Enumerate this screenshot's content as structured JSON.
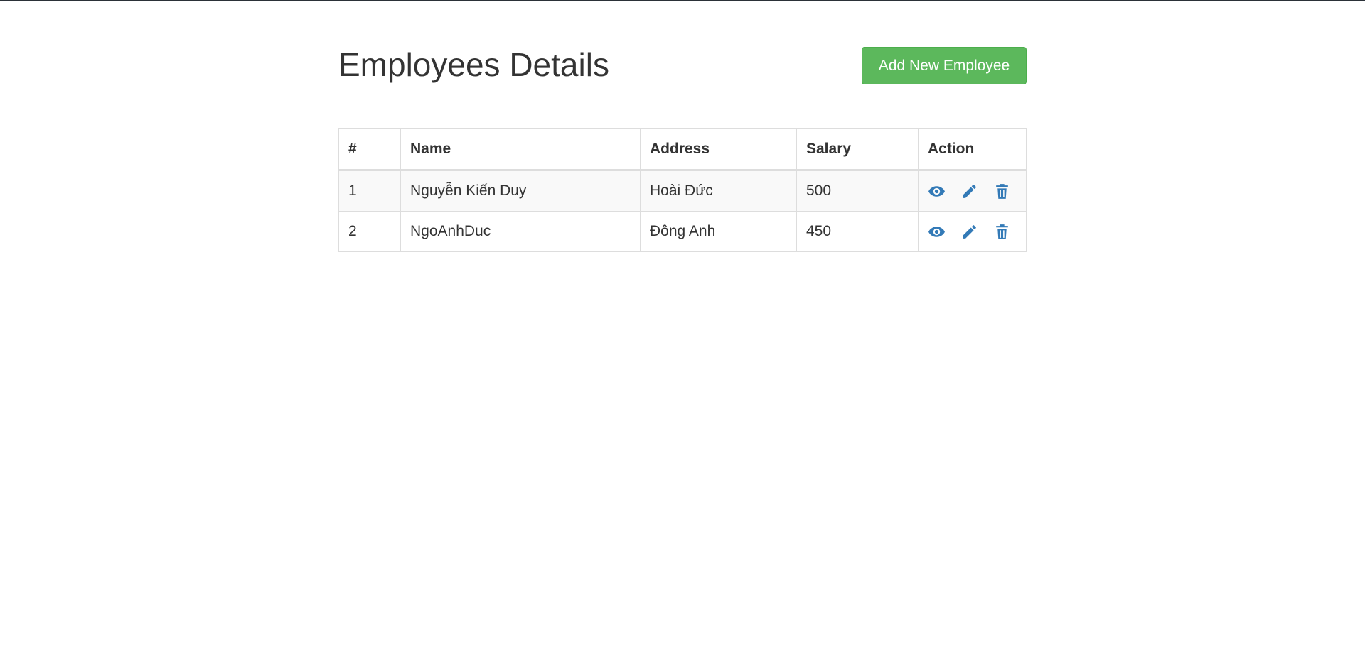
{
  "page": {
    "title": "Employees Details",
    "add_button_label": "Add New Employee"
  },
  "table": {
    "headers": [
      "#",
      "Name",
      "Address",
      "Salary",
      "Action"
    ],
    "rows": [
      {
        "num": "1",
        "name": "Nguyễn Kiến Duy",
        "address": "Hoài Đức",
        "salary": "500"
      },
      {
        "num": "2",
        "name": "NgoAnhDuc",
        "address": "Đông Anh",
        "salary": "450"
      }
    ],
    "action_icons": [
      "eye-icon",
      "pencil-icon",
      "trash-icon"
    ]
  },
  "colors": {
    "accent_green": "#5cb85c",
    "icon_blue": "#337ab7"
  }
}
